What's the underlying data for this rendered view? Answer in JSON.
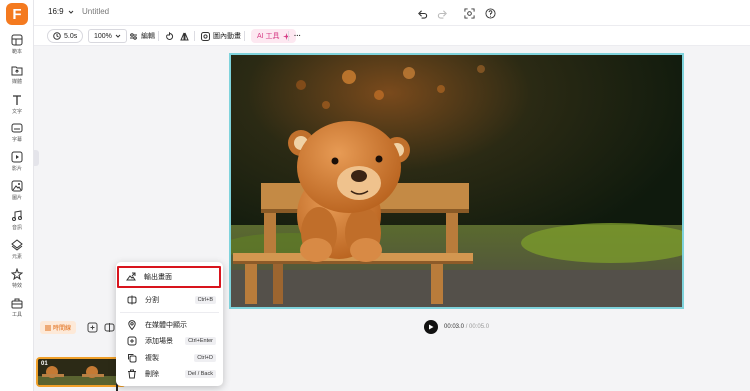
{
  "app": {
    "logo_letter": "F",
    "brand_color": "#f47a1f",
    "accent_ai": "#d63d86",
    "highlight_color": "#d8141d",
    "selection_color": "#7fd3dc"
  },
  "sidebar": {
    "items": [
      {
        "label": "範本",
        "icon": "template-icon"
      },
      {
        "label": "媒體",
        "icon": "media-upload-icon"
      },
      {
        "label": "文字",
        "icon": "text-icon"
      },
      {
        "label": "字幕",
        "icon": "caption-icon"
      },
      {
        "label": "影片",
        "icon": "video-icon"
      },
      {
        "label": "圖片",
        "icon": "image-icon"
      },
      {
        "label": "音訊",
        "icon": "music-icon"
      },
      {
        "label": "元素",
        "icon": "elements-icon"
      },
      {
        "label": "特效",
        "icon": "effects-icon"
      },
      {
        "label": "工具",
        "icon": "toolbox-icon"
      }
    ]
  },
  "topbar": {
    "aspect_ratio": "16:9",
    "title": "Untitled"
  },
  "toolbar": {
    "duration": "5.0s",
    "zoom": "100%",
    "edit_label": "編輯",
    "animation_label": "圖內動畫",
    "ai_tools_label": "AI 工具",
    "more_label": "···"
  },
  "player": {
    "current_time": "00:03.0",
    "total_time": "/ 00:05.0"
  },
  "timeline": {
    "toggle_label": "時間線",
    "clip_number": "01"
  },
  "context_menu": {
    "items": [
      {
        "label": "輸出畫面",
        "shortcut": "",
        "icon": "export-frame-icon",
        "highlighted": true
      },
      {
        "label": "分割",
        "shortcut": "Ctrl+B",
        "icon": "split-icon",
        "highlighted": false
      },
      {
        "label": "在媒體中顯示",
        "shortcut": "",
        "icon": "location-pin-icon",
        "highlighted": false
      },
      {
        "label": "添加場景",
        "shortcut": "Ctrl+Enter",
        "icon": "add-scene-icon",
        "highlighted": false
      },
      {
        "label": "複製",
        "shortcut": "Ctrl+D",
        "icon": "duplicate-icon",
        "highlighted": false
      },
      {
        "label": "刪除",
        "shortcut": "Del / Back",
        "icon": "trash-icon",
        "highlighted": false
      }
    ]
  }
}
